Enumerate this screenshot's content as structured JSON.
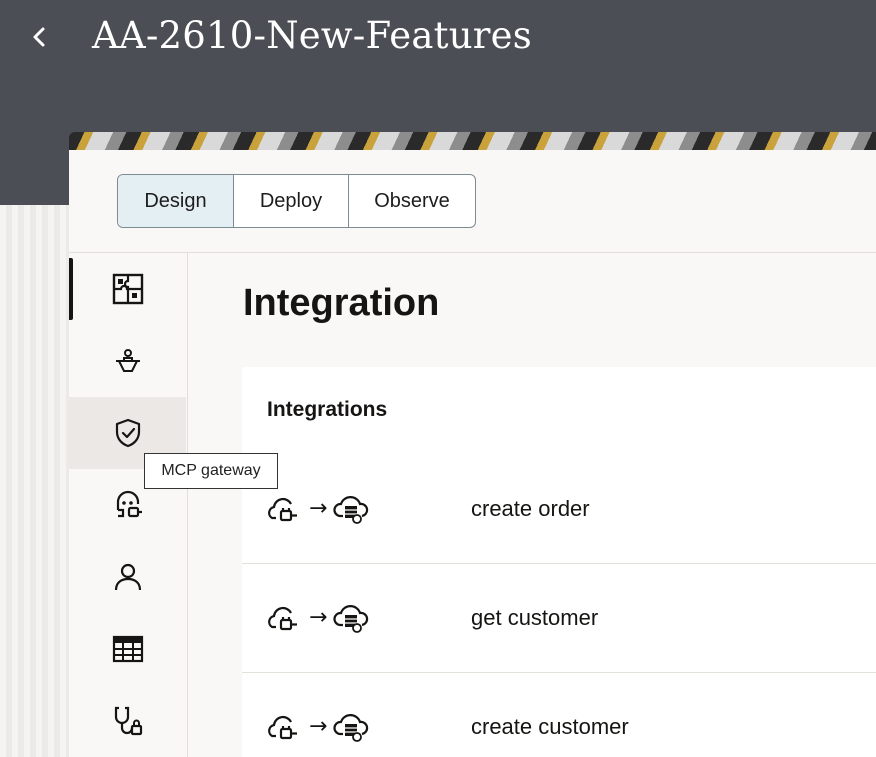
{
  "header": {
    "title": "AA-2610-New-Features",
    "back_icon": "chevron-left-icon"
  },
  "tabs": [
    {
      "label": "Design",
      "active": true
    },
    {
      "label": "Deploy",
      "active": false
    },
    {
      "label": "Observe",
      "active": false
    }
  ],
  "nav": {
    "items": [
      {
        "icon": "puzzle-icon",
        "active": true
      },
      {
        "icon": "agent-icon",
        "active": false
      },
      {
        "icon": "shield-check-icon",
        "active": false,
        "hovered": true
      },
      {
        "icon": "robot-plug-icon",
        "active": false
      },
      {
        "icon": "person-icon",
        "active": false
      },
      {
        "icon": "table-icon",
        "active": false
      },
      {
        "icon": "stethoscope-icon",
        "active": false
      }
    ],
    "tooltip": "MCP gateway"
  },
  "main": {
    "page_title": "Integration",
    "section_title": "Integrations",
    "integrations": [
      {
        "name": "create order",
        "source_icon": "cloud-plug-icon",
        "target_icon": "cloud-database-icon"
      },
      {
        "name": "get customer",
        "source_icon": "cloud-plug-icon",
        "target_icon": "cloud-database-icon"
      },
      {
        "name": "create customer",
        "source_icon": "cloud-plug-icon",
        "target_icon": "cloud-database-icon"
      }
    ],
    "arrow": "→"
  },
  "colors": {
    "header_bg": "#4b4e54",
    "active_tab_bg": "#e4eff4",
    "text": "#161513"
  }
}
